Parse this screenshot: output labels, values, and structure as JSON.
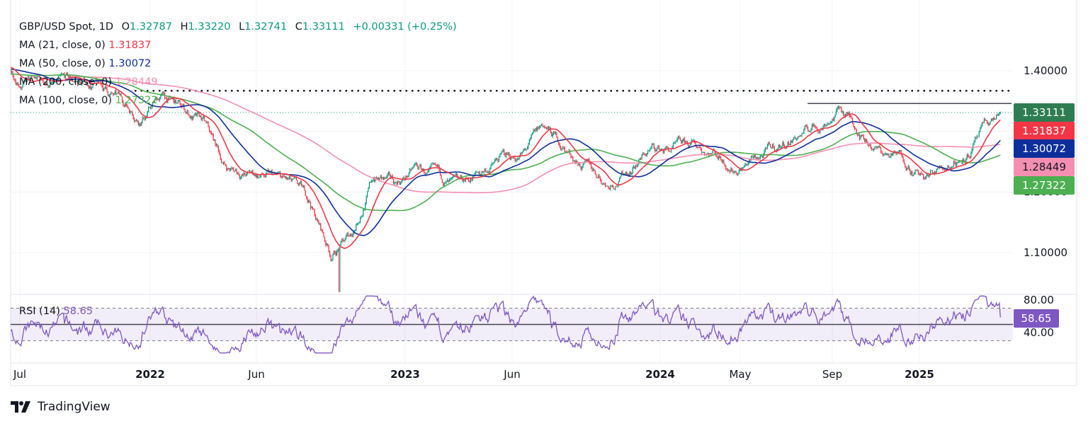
{
  "header": {
    "symbol": "GBP/USD Spot, 1D",
    "open_label": "O",
    "open": "1.32787",
    "high_label": "H",
    "high": "1.33220",
    "low_label": "L",
    "low": "1.32741",
    "close_label": "C",
    "close": "1.33111",
    "change": "+0.00331 (+0.25%)"
  },
  "indicators": [
    {
      "label": "MA (21, close, 0)",
      "value": "1.31837",
      "color": "#f23645"
    },
    {
      "label": "MA (50, close, 0)",
      "value": "1.30072",
      "color": "#0d2f9c"
    },
    {
      "label": "MA (200, close, 0)",
      "value": "1.28449",
      "color": "#f48fb1"
    },
    {
      "label": "MA (100, close, 0)",
      "value": "1.27322",
      "color": "#4caf50"
    }
  ],
  "price_badge": {
    "value": "1.33111",
    "color": "#2e7d52"
  },
  "rsi": {
    "label": "RSI (14)",
    "value": "58.65",
    "color": "#7e57c2",
    "axis": [
      "80.00",
      "40.00"
    ],
    "bands": [
      70,
      30
    ],
    "mid": 50
  },
  "price_axis": [
    "1.40000",
    "1.20000",
    "1.10000"
  ],
  "x_axis": [
    {
      "label": "Jul",
      "year": false
    },
    {
      "label": "2022",
      "year": true
    },
    {
      "label": "Jun",
      "year": false
    },
    {
      "label": "2023",
      "year": true
    },
    {
      "label": "Jun",
      "year": false
    },
    {
      "label": "2024",
      "year": true
    },
    {
      "label": "May",
      "year": false
    },
    {
      "label": "Sep",
      "year": false
    },
    {
      "label": "2025",
      "year": true
    }
  ],
  "brand": "TradingView",
  "chart_data": {
    "type": "candlestick",
    "title": "GBP/USD Spot, 1D",
    "ylim": [
      1.03,
      1.43
    ],
    "last": {
      "open": 1.32787,
      "high": 1.3322,
      "low": 1.32741,
      "close": 1.33111
    },
    "approx_closes": [
      [
        "2021-07",
        1.39
      ],
      [
        "2021-08",
        1.375
      ],
      [
        "2021-10",
        1.376
      ],
      [
        "2021-12",
        1.325
      ],
      [
        "2022-01",
        1.36
      ],
      [
        "2022-03",
        1.31
      ],
      [
        "2022-04",
        1.24
      ],
      [
        "2022-05",
        1.23
      ],
      [
        "2022-06",
        1.225
      ],
      [
        "2022-07",
        1.21
      ],
      [
        "2022-08",
        1.18
      ],
      [
        "2022-09",
        1.097
      ],
      [
        "2022-10",
        1.13
      ],
      [
        "2022-11",
        1.225
      ],
      [
        "2022-12",
        1.21
      ],
      [
        "2023-01",
        1.237
      ],
      [
        "2023-03",
        1.2
      ],
      [
        "2023-05",
        1.255
      ],
      [
        "2023-06",
        1.26
      ],
      [
        "2023-07",
        1.305
      ],
      [
        "2023-08",
        1.27
      ],
      [
        "2023-10",
        1.215
      ],
      [
        "2023-11",
        1.24
      ],
      [
        "2023-12",
        1.27
      ],
      [
        "2024-03",
        1.27
      ],
      [
        "2024-04",
        1.245
      ],
      [
        "2024-06",
        1.27
      ],
      [
        "2024-07",
        1.295
      ],
      [
        "2024-08",
        1.31
      ],
      [
        "2024-09",
        1.34
      ],
      [
        "2024-10",
        1.3
      ],
      [
        "2024-11",
        1.265
      ],
      [
        "2024-12",
        1.255
      ],
      [
        "2025-01",
        1.22
      ],
      [
        "2025-02",
        1.245
      ],
      [
        "2025-03",
        1.27
      ],
      [
        "2025-04",
        1.33111
      ]
    ],
    "lows": {
      "2022-09": 1.035
    },
    "horizontal_lines": [
      {
        "price": 1.367,
        "style": "dotted",
        "color": "#131722"
      },
      {
        "price": 1.346,
        "style": "solid",
        "color": "#434651"
      }
    ],
    "moving_averages": [
      21,
      50,
      100,
      200
    ],
    "rsi_period": 14
  }
}
